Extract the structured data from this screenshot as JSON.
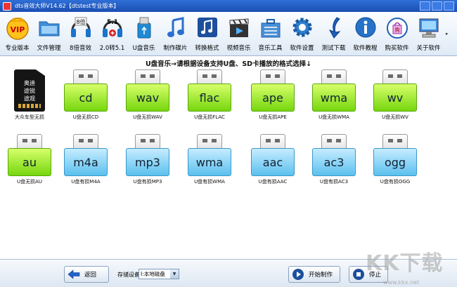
{
  "window": {
    "title": "dts音效大师V14.62【dtstest专业版本】"
  },
  "toolbar": {
    "items": [
      {
        "label": "专业版本",
        "icon": "vip-icon"
      },
      {
        "label": "文件管理",
        "icon": "folder-icon"
      },
      {
        "label": "8倍音效",
        "icon": "headphone-8x-icon"
      },
      {
        "label": "2.0转5.1",
        "icon": "surround-icon"
      },
      {
        "label": "U盘音乐",
        "icon": "usb-drive-icon"
      },
      {
        "label": "制作碟片",
        "icon": "music-note-icon"
      },
      {
        "label": "转换格式",
        "icon": "convert-music-icon"
      },
      {
        "label": "视频音乐",
        "icon": "video-clapper-icon"
      },
      {
        "label": "音乐工具",
        "icon": "toolbox-icon"
      },
      {
        "label": "软件设置",
        "icon": "gear-icon"
      },
      {
        "label": "测试下载",
        "icon": "download-arrow-icon"
      },
      {
        "label": "软件教程",
        "icon": "info-icon"
      },
      {
        "label": "购买软件",
        "icon": "shopping-bag-icon"
      },
      {
        "label": "关于软件",
        "icon": "computer-icon"
      }
    ]
  },
  "main": {
    "instruction": "U盘音乐→请根据设备支持U盘、SD卡播放的格式选择↓",
    "sd_card": {
      "text_lines": [
        "奥迪",
        "途锐",
        "途观"
      ],
      "label": "大众车型无损"
    },
    "formats": [
      {
        "name": "cd",
        "label": "U盘无损CD",
        "color": "green"
      },
      {
        "name": "wav",
        "label": "U盘无损WAV",
        "color": "green"
      },
      {
        "name": "flac",
        "label": "U盘无损FLAC",
        "color": "green"
      },
      {
        "name": "ape",
        "label": "U盘无损APE",
        "color": "green"
      },
      {
        "name": "wma",
        "label": "U盘无损WMA",
        "color": "green"
      },
      {
        "name": "wv",
        "label": "U盘无损WV",
        "color": "green"
      },
      {
        "name": "au",
        "label": "U盘无损AU",
        "color": "green"
      },
      {
        "name": "m4a",
        "label": "U盘有损M4A",
        "color": "blue"
      },
      {
        "name": "mp3",
        "label": "U盘有损MP3",
        "color": "blue"
      },
      {
        "name": "wma",
        "label": "U盘有损WMA",
        "color": "blue"
      },
      {
        "name": "aac",
        "label": "U盘有损AAC",
        "color": "blue"
      },
      {
        "name": "ac3",
        "label": "U盘有损AC3",
        "color": "blue"
      },
      {
        "name": "ogg",
        "label": "U盘有损OGG",
        "color": "blue"
      }
    ]
  },
  "bottom": {
    "back_label": "返回",
    "device_label": "存储设备",
    "device_value": "I:本地磁盘",
    "start_label": "开始制作",
    "stop_label": "停止"
  },
  "watermark": {
    "text": "KK下载",
    "url": "www.kkx.net"
  }
}
